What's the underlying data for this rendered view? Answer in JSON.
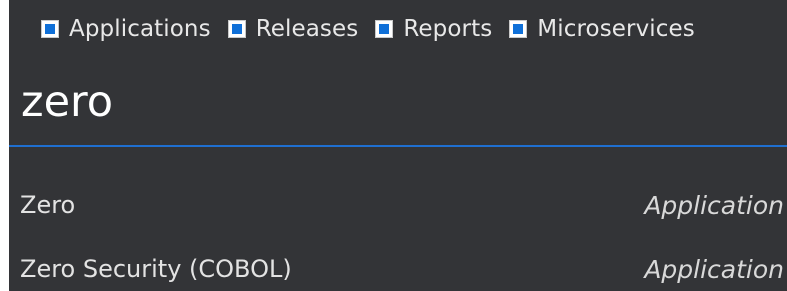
{
  "filters": [
    {
      "label": "Applications",
      "checked": true
    },
    {
      "label": "Releases",
      "checked": true
    },
    {
      "label": "Reports",
      "checked": true
    },
    {
      "label": "Microservices",
      "checked": true
    }
  ],
  "search": {
    "value": "zero"
  },
  "results": [
    {
      "name": "Zero",
      "type": "Application"
    },
    {
      "name": "Zero Security (COBOL)",
      "type": "Application"
    }
  ],
  "colors": {
    "panel_background": "#333437",
    "accent": "#1070d8",
    "underline": "#1f6fd0"
  }
}
